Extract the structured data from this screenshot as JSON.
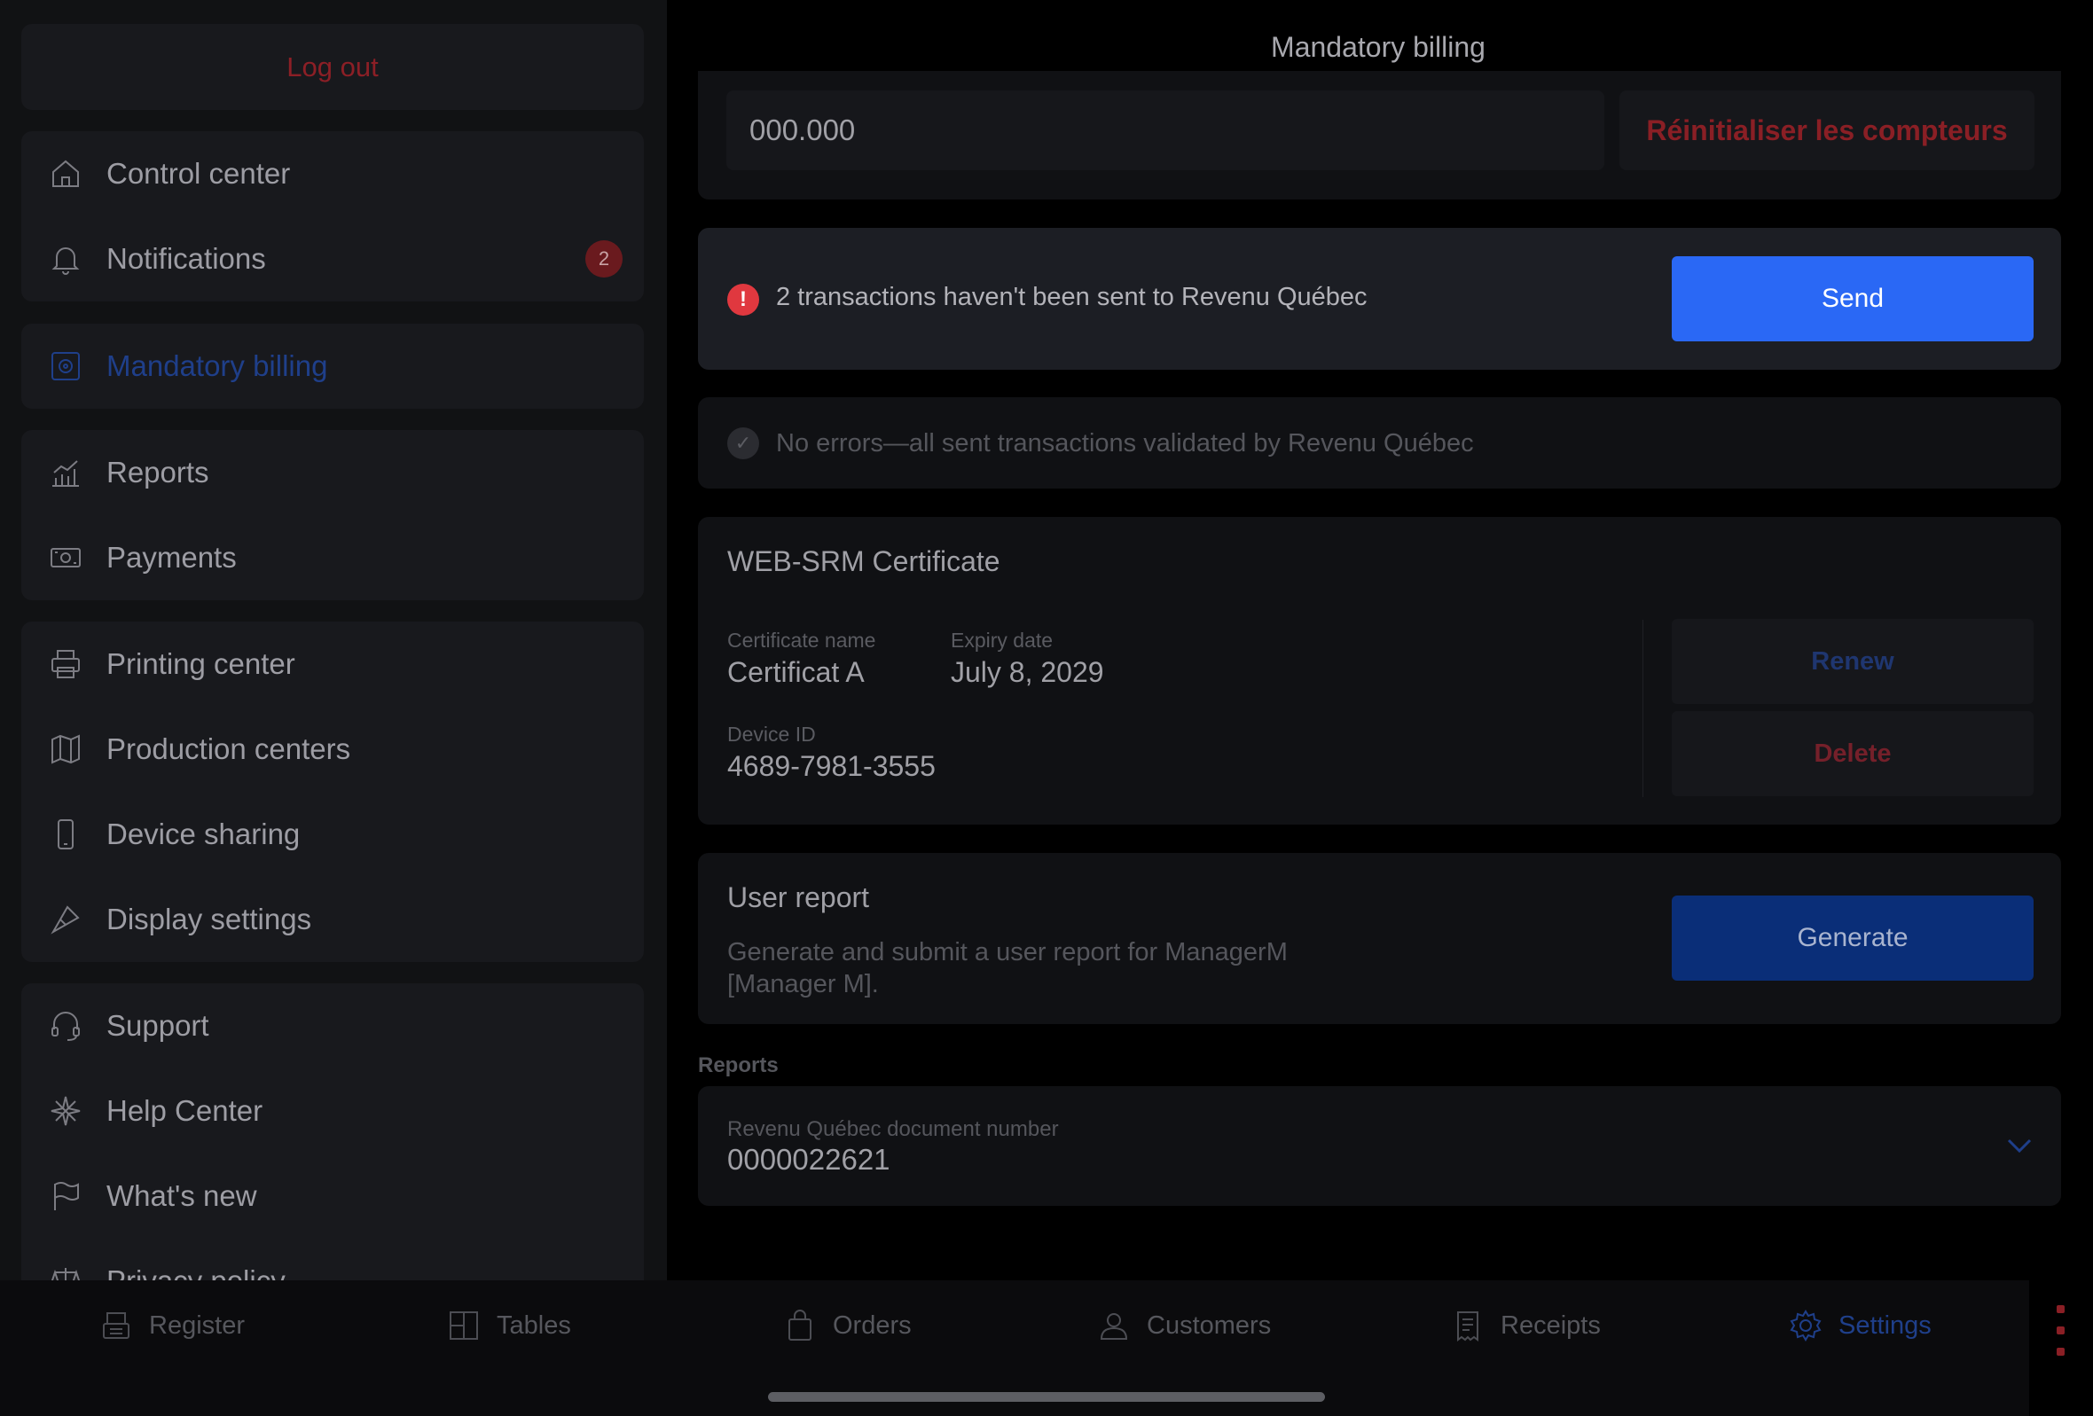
{
  "page_title": "Mandatory billing",
  "sidebar": {
    "logout_label": "Log out",
    "group1": [
      {
        "label": "Control center",
        "icon": "home-icon"
      },
      {
        "label": "Notifications",
        "icon": "bell-icon",
        "badge": "2"
      }
    ],
    "group2": [
      {
        "label": "Mandatory billing",
        "icon": "billing-icon",
        "active": true
      }
    ],
    "group3": [
      {
        "label": "Reports",
        "icon": "chart-icon"
      },
      {
        "label": "Payments",
        "icon": "cash-icon"
      }
    ],
    "group4": [
      {
        "label": "Printing center",
        "icon": "printer-icon"
      },
      {
        "label": "Production centers",
        "icon": "map-icon"
      },
      {
        "label": "Device sharing",
        "icon": "phone-icon"
      },
      {
        "label": "Display settings",
        "icon": "brush-icon"
      }
    ],
    "group5": [
      {
        "label": "Support",
        "icon": "headset-icon"
      },
      {
        "label": "Help Center",
        "icon": "sparkle-icon"
      },
      {
        "label": "What's new",
        "icon": "flag-icon"
      },
      {
        "label": "Privacy policy",
        "icon": "scale-icon"
      }
    ]
  },
  "counters": {
    "value": "000.000",
    "reset_label": "Réinitialiser les compteurs"
  },
  "alert": {
    "message": "2 transactions haven't been sent to Revenu Québec",
    "send_label": "Send"
  },
  "status_ok": {
    "message": "No errors—all sent transactions validated by Revenu Québec"
  },
  "certificate": {
    "title": "WEB-SRM Certificate",
    "name_label": "Certificate name",
    "name_value": "Certificat A",
    "expiry_label": "Expiry date",
    "expiry_value": "July 8, 2029",
    "device_label": "Device ID",
    "device_value": "4689-7981-3555",
    "renew_label": "Renew",
    "delete_label": "Delete"
  },
  "user_report": {
    "title": "User report",
    "description": "Generate and submit a user report for ManagerM [Manager M].",
    "generate_label": "Generate"
  },
  "reports": {
    "section_label": "Reports",
    "doc_number_label": "Revenu Québec document number",
    "doc_number_value": "0000022621"
  },
  "tabbar": {
    "tabs": [
      {
        "label": "Register",
        "icon": "register-icon"
      },
      {
        "label": "Tables",
        "icon": "tables-icon"
      },
      {
        "label": "Orders",
        "icon": "bag-icon"
      },
      {
        "label": "Customers",
        "icon": "user-icon"
      },
      {
        "label": "Receipts",
        "icon": "receipt-icon"
      },
      {
        "label": "Settings",
        "icon": "gear-icon",
        "active": true
      }
    ]
  },
  "colors": {
    "accent": "#2a68f5",
    "danger": "#e0383f",
    "active_nav": "#1f3f8a"
  }
}
